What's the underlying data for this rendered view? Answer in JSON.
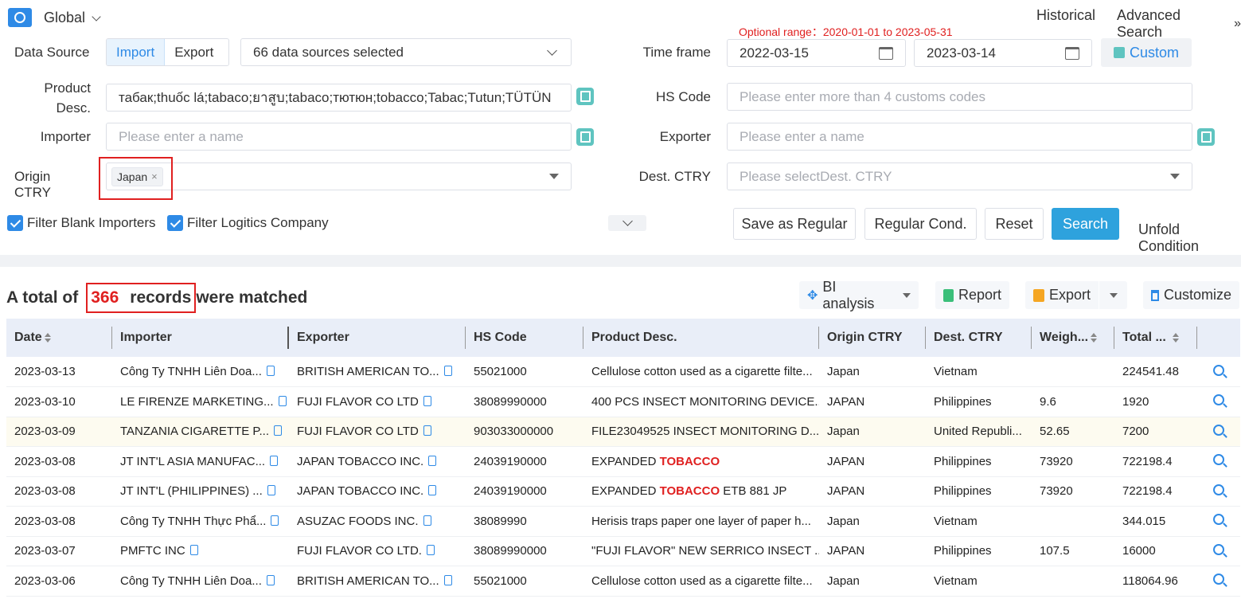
{
  "top": {
    "region": "Global",
    "historical": "Historical",
    "advanced_search": "Advanced Search",
    "optional_range": "Optional range：2020-01-01 to 2023-05-31"
  },
  "form": {
    "data_source_label": "Data Source",
    "import_label": "Import",
    "export_label": "Export",
    "sources_selected": "66 data sources selected",
    "time_frame_label": "Time frame",
    "date_from": "2022-03-15",
    "date_to": "2023-03-14",
    "custom_label": "Custom",
    "product_desc_label_1": "Product",
    "product_desc_label_2": "Desc.",
    "product_desc_value": "табак;thuốc lá;tabaco;ยาสูบ;tabaco;тютюн;tobacco;Tabac;Tutun;TÜTÜN",
    "hs_code_label": "HS Code",
    "hs_code_placeholder": "Please enter more than 4 customs codes",
    "importer_label": "Importer",
    "importer_placeholder": "Please enter a name",
    "exporter_label": "Exporter",
    "exporter_placeholder": "Please enter a name",
    "origin_label": "Origin CTRY",
    "origin_tag": "Japan",
    "dest_label": "Dest. CTRY",
    "dest_placeholder": "Please selectDest. CTRY",
    "filter_blank_importers": "Filter Blank Importers",
    "filter_logistics": "Filter Logitics Company",
    "save_regular": "Save as Regular",
    "regular_cond": "Regular Cond.",
    "reset": "Reset",
    "search": "Search",
    "unfold": "Unfold Condition"
  },
  "results": {
    "prefix": "A total of",
    "count": "366",
    "records": "records",
    "suffix": "were matched",
    "bi_analysis": "BI analysis",
    "report": "Report",
    "export": "Export",
    "customize": "Customize"
  },
  "table": {
    "columns": [
      "Date",
      "Importer",
      "Exporter",
      "HS Code",
      "Product Desc.",
      "Origin CTRY",
      "Dest. CTRY",
      "Weigh...",
      "Total ..."
    ],
    "rows": [
      {
        "date": "2023-03-13",
        "importer": "Công Ty TNHH Liên Doa...",
        "exporter": "BRITISH AMERICAN TO...",
        "hs": "55021000",
        "desc_a": "Cellulose cotton used as a cigarette filte...",
        "desc_kw": "",
        "desc_b": "",
        "origin": "Japan",
        "dest": "Vietnam",
        "weight": "",
        "total": "224541.48"
      },
      {
        "date": "2023-03-10",
        "importer": "LE FIRENZE MARKETING...",
        "exporter": "FUJI FLAVOR CO LTD",
        "hs": "38089990000",
        "desc_a": "400 PCS INSECT MONITORING DEVICE...",
        "desc_kw": "",
        "desc_b": "",
        "origin": "JAPAN",
        "dest": "Philippines",
        "weight": "9.6",
        "total": "1920"
      },
      {
        "date": "2023-03-09",
        "importer": "TANZANIA CIGARETTE P...",
        "exporter": "FUJI FLAVOR CO LTD",
        "hs": "903033000000",
        "desc_a": "FILE23049525 INSECT MONITORING D...",
        "desc_kw": "",
        "desc_b": "",
        "origin": "Japan",
        "dest": "United Republi...",
        "weight": "52.65",
        "total": "7200"
      },
      {
        "date": "2023-03-08",
        "importer": "JT INT'L ASIA MANUFAC...",
        "exporter": "JAPAN TOBACCO INC.",
        "hs": "24039190000",
        "desc_a": "EXPANDED ",
        "desc_kw": "TOBACCO",
        "desc_b": "",
        "origin": "JAPAN",
        "dest": "Philippines",
        "weight": "73920",
        "total": "722198.4"
      },
      {
        "date": "2023-03-08",
        "importer": "JT INT'L (PHILIPPINES) ...",
        "exporter": "JAPAN TOBACCO INC.",
        "hs": "24039190000",
        "desc_a": "EXPANDED ",
        "desc_kw": "TOBACCO",
        "desc_b": " ETB 881 JP",
        "origin": "JAPAN",
        "dest": "Philippines",
        "weight": "73920",
        "total": "722198.4"
      },
      {
        "date": "2023-03-08",
        "importer": "Công Ty TNHH Thực Phẩ...",
        "exporter": "ASUZAC FOODS INC.",
        "hs": "38089990",
        "desc_a": "Herisis traps paper one layer of paper h...",
        "desc_kw": "",
        "desc_b": "",
        "origin": "Japan",
        "dest": "Vietnam",
        "weight": "",
        "total": "344.015"
      },
      {
        "date": "2023-03-07",
        "importer": "PMFTC INC",
        "exporter": "FUJI FLAVOR CO LTD.",
        "hs": "38089990000",
        "desc_a": "\"FUJI FLAVOR\" NEW SERRICO INSECT ...",
        "desc_kw": "",
        "desc_b": "",
        "origin": "JAPAN",
        "dest": "Philippines",
        "weight": "107.5",
        "total": "16000"
      },
      {
        "date": "2023-03-06",
        "importer": "Công Ty TNHH Liên Doa...",
        "exporter": "BRITISH AMERICAN TO...",
        "hs": "55021000",
        "desc_a": "Cellulose cotton used as a cigarette filte...",
        "desc_kw": "",
        "desc_b": "",
        "origin": "Japan",
        "dest": "Vietnam",
        "weight": "",
        "total": "118064.96"
      }
    ]
  },
  "colors": {
    "accent": "#2e8ae6",
    "highlight_red": "#e02020",
    "header_bg": "#e9eef8"
  }
}
